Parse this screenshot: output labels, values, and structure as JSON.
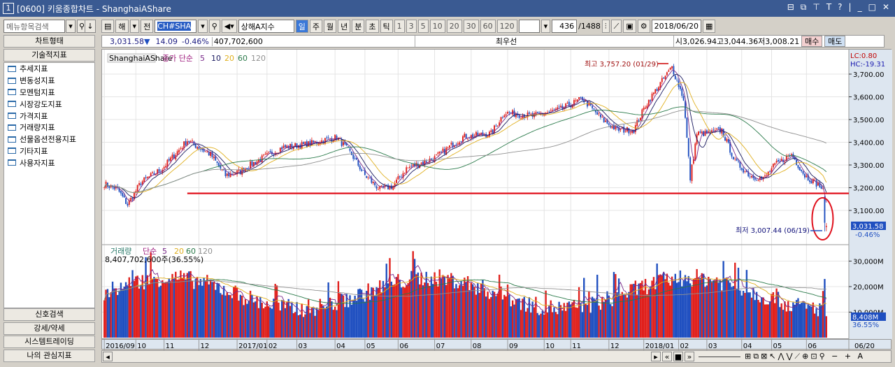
{
  "window": {
    "number": "1",
    "title": "[0600] 키움종합차트 - ShanghaiAShare",
    "icons": [
      "restore-small",
      "tile",
      "pin",
      "T",
      "?",
      "minimize",
      "maximize",
      "close"
    ]
  },
  "sidebar": {
    "search_placeholder": "메뉴항목검색",
    "chart_type": "차트형태",
    "technical": "기술적지표",
    "items": [
      "추세지표",
      "변동성지표",
      "모멘텀지표",
      "시장강도지표",
      "가격지표",
      "거래량지표",
      "선물옵션전용지표",
      "기타지표",
      "사용자지표"
    ],
    "bottom": [
      "신호검색",
      "강세/약세",
      "시스템트레이딩",
      "나의 관심지표"
    ]
  },
  "toolbar": {
    "market": "해",
    "prev": "전",
    "code": "CH#SHA",
    "name": "상해A지수",
    "periods": [
      "일",
      "주",
      "월",
      "년",
      "분",
      "초",
      "틱"
    ],
    "active_period": "일",
    "intervals": [
      "1",
      "3",
      "5",
      "10",
      "20",
      "30",
      "60",
      "120"
    ],
    "count": "436",
    "total": "/1488",
    "date": "2018/06/20"
  },
  "info": {
    "price": "3,031.58",
    "arrow": "▼",
    "change": "14.09",
    "pct": "-0.46%",
    "volume": "407,702,600",
    "priority": "최우선",
    "ohl": "시3,026.94고3,044.36저3,008.21",
    "buy": "매수",
    "sell": "매도"
  },
  "price_panel": {
    "series_label": "ShanghaiAShare",
    "ma_title": "종가 단순",
    "ma": [
      "5",
      "10",
      "20",
      "60",
      "120"
    ],
    "lc": "LC:0.80",
    "hc": "HC:-19.31",
    "high_label": "최고 3,757.20 (01/29)",
    "low_label": "최저 3,007.44 (06/19)",
    "last_price": "3,031.58",
    "last_pct": "-0.46%"
  },
  "volume_panel": {
    "title": "거래량",
    "ma_title": "단순",
    "ma": [
      "5",
      "20",
      "60",
      "120"
    ],
    "summary": "8,407,702,600주(36.55%)",
    "last": "8,408M",
    "last_pct": "36.55%"
  },
  "colors": {
    "up": "#e0201c",
    "down": "#1f4fc0",
    "ma5": "#7a2a8a",
    "ma10": "#1a1a60",
    "ma20": "#e0b020",
    "ma60": "#2a7a4a",
    "ma120": "#909090",
    "support": "#e0101c"
  },
  "chart_data": {
    "type": "candlestick",
    "bars": 436,
    "ylim": [
      3000,
      3800
    ],
    "yticks": [
      "3,700.00",
      "3,600.00",
      "3,500.00",
      "3,400.00",
      "3,300.00",
      "3,200.00",
      "3,100.00"
    ],
    "ytick_values": [
      3700,
      3600,
      3500,
      3400,
      3300,
      3200,
      3100
    ],
    "vol_ticks": [
      "30,000M",
      "20,000M",
      "10,000M"
    ],
    "vol_tick_values": [
      30000,
      20000,
      10000
    ],
    "vol_max": 40000,
    "support_level": 3175,
    "xticks": [
      {
        "label": "2016/09",
        "bar": 0
      },
      {
        "label": "10",
        "bar": 19
      },
      {
        "label": "11",
        "bar": 36
      },
      {
        "label": "12",
        "bar": 57
      },
      {
        "label": "2017/01",
        "bar": 80
      },
      {
        "label": "02",
        "bar": 98
      },
      {
        "label": "03",
        "bar": 116
      },
      {
        "label": "04",
        "bar": 139
      },
      {
        "label": "05",
        "bar": 157
      },
      {
        "label": "06",
        "bar": 177
      },
      {
        "label": "07",
        "bar": 199
      },
      {
        "label": "08",
        "bar": 221
      },
      {
        "label": "09",
        "bar": 243
      },
      {
        "label": "10",
        "bar": 265
      },
      {
        "label": "11",
        "bar": 281
      },
      {
        "label": "12",
        "bar": 304
      },
      {
        "label": "2018/01",
        "bar": 325
      },
      {
        "label": "02",
        "bar": 346
      },
      {
        "label": "03",
        "bar": 363
      },
      {
        "label": "04",
        "bar": 384
      },
      {
        "label": "05",
        "bar": 402
      },
      {
        "label": "06",
        "bar": 423
      }
    ],
    "last_xlabel": "06/20",
    "close_anchors": [
      [
        0,
        3217
      ],
      [
        8,
        3192
      ],
      [
        14,
        3125
      ],
      [
        22,
        3223
      ],
      [
        35,
        3285
      ],
      [
        50,
        3408
      ],
      [
        57,
        3377
      ],
      [
        64,
        3346
      ],
      [
        73,
        3254
      ],
      [
        81,
        3269
      ],
      [
        90,
        3309
      ],
      [
        107,
        3377
      ],
      [
        123,
        3392
      ],
      [
        140,
        3423
      ],
      [
        149,
        3346
      ],
      [
        157,
        3254
      ],
      [
        166,
        3192
      ],
      [
        174,
        3208
      ],
      [
        182,
        3285
      ],
      [
        199,
        3331
      ],
      [
        216,
        3423
      ],
      [
        233,
        3438
      ],
      [
        241,
        3531
      ],
      [
        258,
        3515
      ],
      [
        275,
        3546
      ],
      [
        288,
        3592
      ],
      [
        300,
        3500
      ],
      [
        309,
        3454
      ],
      [
        319,
        3454
      ],
      [
        326,
        3562
      ],
      [
        336,
        3669
      ],
      [
        342,
        3731
      ],
      [
        349,
        3592
      ],
      [
        353,
        3240
      ],
      [
        357,
        3438
      ],
      [
        364,
        3438
      ],
      [
        372,
        3454
      ],
      [
        380,
        3315
      ],
      [
        389,
        3254
      ],
      [
        397,
        3238
      ],
      [
        404,
        3300
      ],
      [
        414,
        3346
      ],
      [
        422,
        3254
      ],
      [
        431,
        3208
      ],
      [
        434,
        3177
      ],
      [
        435,
        3031
      ]
    ],
    "high": {
      "value": 3757.2,
      "date": "01/29"
    },
    "low": {
      "value": 3007.44,
      "date": "06/19"
    }
  }
}
